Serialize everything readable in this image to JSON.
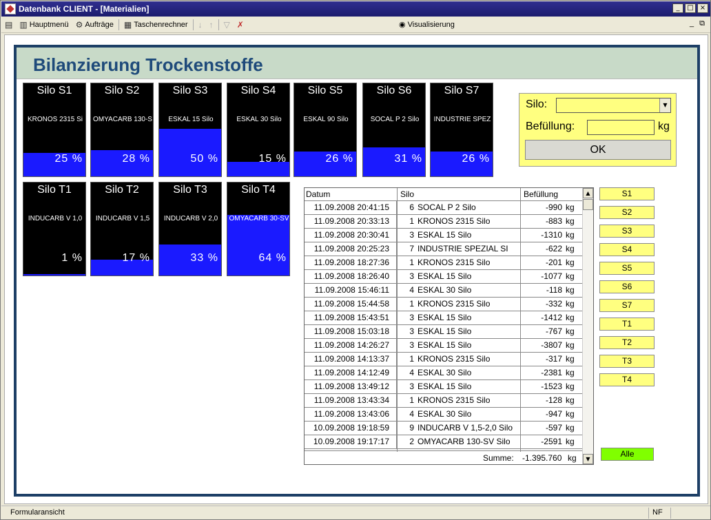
{
  "window": {
    "title": "Datenbank CLIENT - [Materialien]",
    "min": "_",
    "max": "□",
    "close": "×"
  },
  "toolbar": {
    "hauptmenu": "Hauptmenü",
    "auftraege": "Aufträge",
    "taschenrechner": "Taschenrechner",
    "visualisierung": "Visualisierung",
    "mdi_min": "_",
    "mdi_restore": "⧉"
  },
  "page": {
    "title": "Bilanzierung Trockenstoffe"
  },
  "silos_row1": [
    {
      "name": "Silo S1",
      "material": "KRONOS 2315 Si",
      "percent_label": "25 %",
      "fill": 0.25
    },
    {
      "name": "Silo S2",
      "material": "OMYACARB 130-S",
      "percent_label": "28 %",
      "fill": 0.28
    },
    {
      "name": "Silo S3",
      "material": "ESKAL 15 Silo",
      "percent_label": "50 %",
      "fill": 0.5
    },
    {
      "name": "Silo S4",
      "material": "ESKAL 30 Silo",
      "percent_label": "15 %",
      "fill": 0.15
    },
    {
      "name": "Silo S5",
      "material": "ESKAL 90 Silo",
      "percent_label": "26 %",
      "fill": 0.26
    },
    {
      "name": "Silo S6",
      "material": "SOCAL P 2 Silo",
      "percent_label": "31 %",
      "fill": 0.31
    },
    {
      "name": "Silo S7",
      "material": "INDUSTRIE SPEZ",
      "percent_label": "26 %",
      "fill": 0.26
    }
  ],
  "silos_row2": [
    {
      "name": "Silo T1",
      "material": "INDUCARB V 1,0",
      "percent_label": "1 %",
      "fill": 0.01
    },
    {
      "name": "Silo T2",
      "material": "INDUCARB V 1,5",
      "percent_label": "17 %",
      "fill": 0.17
    },
    {
      "name": "Silo T3",
      "material": "INDUCARB V 2,0",
      "percent_label": "33 %",
      "fill": 0.33
    },
    {
      "name": "Silo T4",
      "material": "OMYACARB 30-SV",
      "percent_label": "64 %",
      "fill": 0.64
    }
  ],
  "form": {
    "silo_label": "Silo:",
    "fill_label": "Befüllung:",
    "unit": "kg",
    "ok": "OK",
    "silo_value": "",
    "fill_value": ""
  },
  "table": {
    "headers": {
      "date": "Datum",
      "silo": "Silo",
      "amount": "Befüllung"
    },
    "rows": [
      {
        "date": "11.09.2008 20:41:15",
        "num": "6",
        "name": "SOCAL P 2 Silo",
        "amount": "-990",
        "unit": "kg"
      },
      {
        "date": "11.09.2008 20:33:13",
        "num": "1",
        "name": "KRONOS 2315 Silo",
        "amount": "-883",
        "unit": "kg"
      },
      {
        "date": "11.09.2008 20:30:41",
        "num": "3",
        "name": "ESKAL 15 Silo",
        "amount": "-1310",
        "unit": "kg"
      },
      {
        "date": "11.09.2008 20:25:23",
        "num": "7",
        "name": "INDUSTRIE SPEZIAL SI",
        "amount": "-622",
        "unit": "kg"
      },
      {
        "date": "11.09.2008 18:27:36",
        "num": "1",
        "name": "KRONOS 2315 Silo",
        "amount": "-201",
        "unit": "kg"
      },
      {
        "date": "11.09.2008 18:26:40",
        "num": "3",
        "name": "ESKAL 15 Silo",
        "amount": "-1077",
        "unit": "kg"
      },
      {
        "date": "11.09.2008 15:46:11",
        "num": "4",
        "name": "ESKAL 30 Silo",
        "amount": "-118",
        "unit": "kg"
      },
      {
        "date": "11.09.2008 15:44:58",
        "num": "1",
        "name": "KRONOS 2315 Silo",
        "amount": "-332",
        "unit": "kg"
      },
      {
        "date": "11.09.2008 15:43:51",
        "num": "3",
        "name": "ESKAL 15 Silo",
        "amount": "-1412",
        "unit": "kg"
      },
      {
        "date": "11.09.2008 15:03:18",
        "num": "3",
        "name": "ESKAL 15 Silo",
        "amount": "-767",
        "unit": "kg"
      },
      {
        "date": "11.09.2008 14:26:27",
        "num": "3",
        "name": "ESKAL 15 Silo",
        "amount": "-3807",
        "unit": "kg"
      },
      {
        "date": "11.09.2008 14:13:37",
        "num": "1",
        "name": "KRONOS 2315 Silo",
        "amount": "-317",
        "unit": "kg"
      },
      {
        "date": "11.09.2008 14:12:49",
        "num": "4",
        "name": "ESKAL 30 Silo",
        "amount": "-2381",
        "unit": "kg"
      },
      {
        "date": "11.09.2008 13:49:12",
        "num": "3",
        "name": "ESKAL 15 Silo",
        "amount": "-1523",
        "unit": "kg"
      },
      {
        "date": "11.09.2008 13:43:34",
        "num": "1",
        "name": "KRONOS 2315 Silo",
        "amount": "-128",
        "unit": "kg"
      },
      {
        "date": "11.09.2008 13:43:06",
        "num": "4",
        "name": "ESKAL 30 Silo",
        "amount": "-947",
        "unit": "kg"
      },
      {
        "date": "10.09.2008 19:18:59",
        "num": "9",
        "name": "INDUCARB V 1,5-2,0 Silo",
        "amount": "-597",
        "unit": "kg"
      },
      {
        "date": "10.09.2008 19:17:17",
        "num": "2",
        "name": "OMYACARB 130-SV Silo",
        "amount": "-2591",
        "unit": "kg"
      }
    ],
    "sum_label": "Summe:",
    "sum_value": "-1.395.760",
    "sum_unit": "kg"
  },
  "filter_buttons": [
    "S1",
    "S2",
    "S3",
    "S4",
    "S5",
    "S6",
    "S7",
    "T1",
    "T2",
    "T3",
    "T4"
  ],
  "alle_button": "Alle",
  "status": {
    "text": "Formularansicht",
    "nf": "NF"
  },
  "colors": {
    "fill": "#1a1aff",
    "silo_bg": "#000000",
    "form_bg": "#ffff80",
    "alle": "#80ff00",
    "header_bg": "#c8dac8",
    "title": "#1e4a7a",
    "frame": "#1d3f66"
  }
}
